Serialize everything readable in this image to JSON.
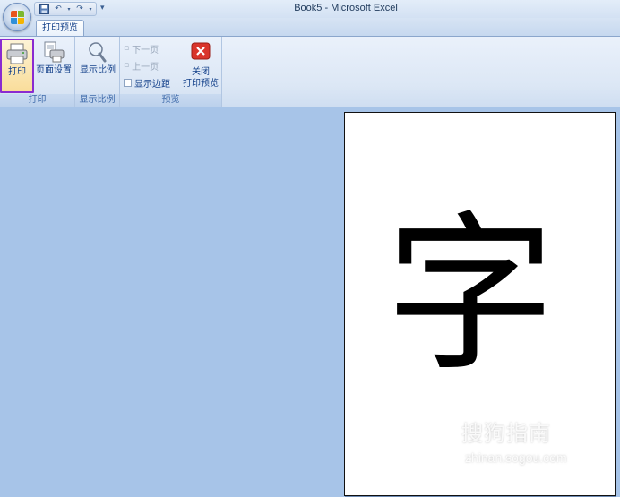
{
  "window": {
    "title": "Book5 - Microsoft Excel"
  },
  "quick_access": {
    "save_icon": "save-icon",
    "undo_icon": "undo-icon",
    "redo_icon": "redo-icon",
    "customize_icon": "customize-qat-icon"
  },
  "tabs": [
    {
      "label": "打印预览",
      "active": true
    }
  ],
  "ribbon": {
    "groups": {
      "print": {
        "label": "打印",
        "print_label": "打印",
        "page_setup_label": "页面设置"
      },
      "zoom": {
        "label": "显示比例",
        "zoom_label": "显示比例"
      },
      "preview": {
        "label": "预览",
        "next_page_label": "下一页",
        "prev_page_label": "上一页",
        "show_margins_label": "显示边距",
        "close_label_1": "关闭",
        "close_label_2": "打印预览"
      }
    }
  },
  "document": {
    "content": "字"
  },
  "watermark": {
    "brand": "搜狗指南",
    "url": "zhinan.sogou.com"
  },
  "colors": {
    "accent_highlight": "#8a2bd0",
    "workspace_bg": "#a7c4e8",
    "close_icon_bg": "#d9342b"
  }
}
